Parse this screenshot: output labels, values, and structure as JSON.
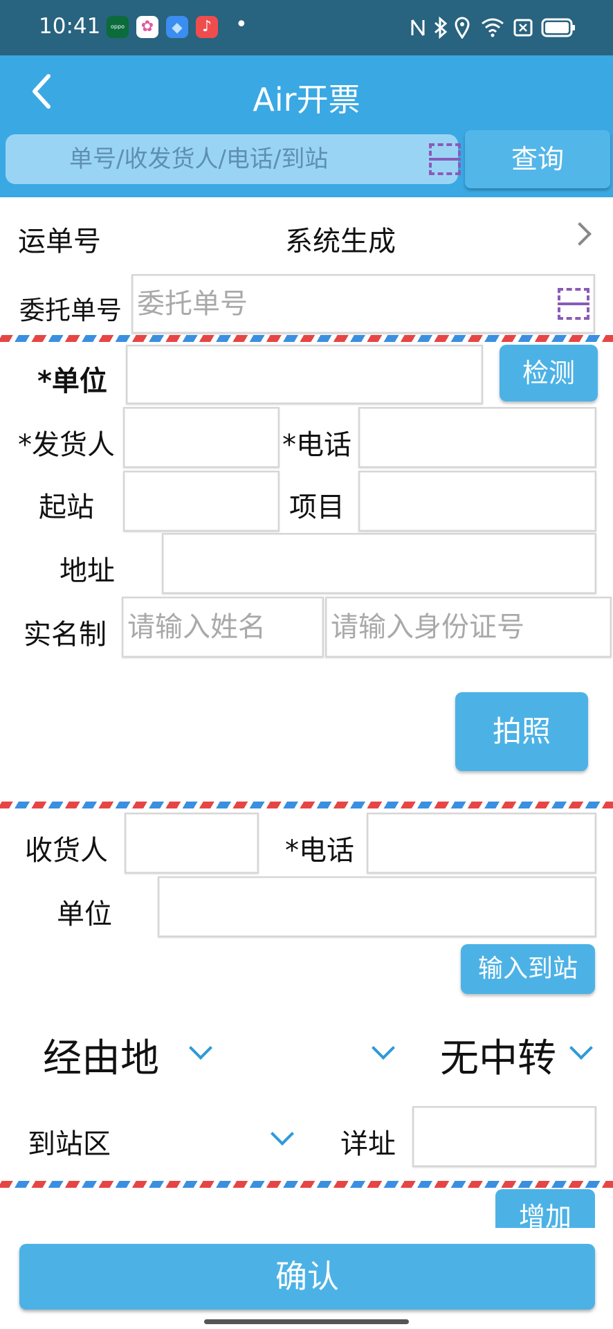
{
  "status_bar": {
    "time": "10:41",
    "app_icons": [
      {
        "name": "oppo-app-icon",
        "color": "#0b6b3a",
        "glyph": "oppo"
      },
      {
        "name": "gallery-app-icon",
        "color": "#ffffff",
        "glyph": "✿"
      },
      {
        "name": "notes-app-icon",
        "color": "#3b8ef0",
        "glyph": "◆"
      },
      {
        "name": "music-app-icon",
        "color": "#ef4d4d",
        "glyph": "♪"
      }
    ],
    "dot": "•",
    "system_icons": [
      "nfc-icon",
      "bluetooth-icon",
      "location-icon",
      "wifi-icon",
      "sim-icon",
      "battery-icon"
    ]
  },
  "header": {
    "title": "Air开票",
    "search_placeholder": "单号/收发货人/电话/到站",
    "query_button": "查询",
    "back_icon": "chevron-left-icon"
  },
  "waybill": {
    "label": "运单号",
    "value": "系统生成"
  },
  "entrust": {
    "label": "委托单号",
    "placeholder": "委托单号"
  },
  "sender": {
    "unit_label": "*单位",
    "detect_button": "检测",
    "shipper_label": "*发货人",
    "phone_label": "*电话",
    "origin_label": "起站",
    "project_label": "项目",
    "address_label": "地址",
    "realname_label": "实名制",
    "name_placeholder": "请输入姓名",
    "id_placeholder": "请输入身份证号",
    "photo_button": "拍照"
  },
  "receiver": {
    "consignee_label": "收货人",
    "phone_label": "*电话",
    "unit_label": "单位",
    "input_station_button": "输入到站"
  },
  "route": {
    "via_label": "经由地",
    "middle_value": "",
    "transfer_value": "无中转",
    "station_area_label": "到站区",
    "detail_address_label": "详址"
  },
  "goods": {
    "add_button": "增加"
  },
  "footer": {
    "confirm_button": "确认"
  },
  "colors": {
    "status_bar": "#28637f",
    "header": "#3aa8e3",
    "button": "#4cb2e6",
    "airmail_red": "#e64545",
    "airmail_blue": "#3b8fe0",
    "scan_icon": "#8a5ab8"
  }
}
